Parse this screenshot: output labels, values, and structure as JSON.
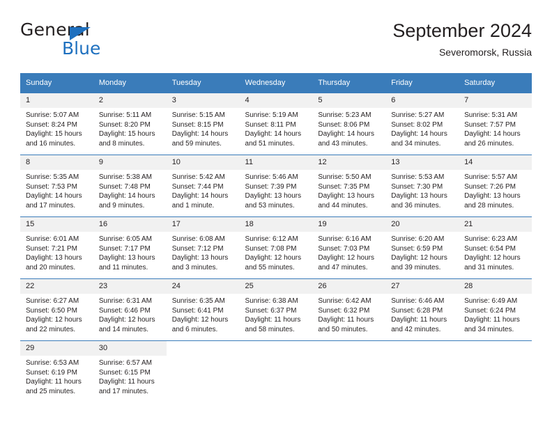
{
  "brand": {
    "name_part1": "General",
    "name_part2": "Blue",
    "triangle_color": "#1e70bf"
  },
  "header": {
    "title": "September 2024",
    "subtitle": "Severomorsk, Russia"
  },
  "theme": {
    "header_blue": "#3a7cba",
    "daynum_bg": "#f1f1f1",
    "text": "#231f20"
  },
  "weekdays": [
    "Sunday",
    "Monday",
    "Tuesday",
    "Wednesday",
    "Thursday",
    "Friday",
    "Saturday"
  ],
  "labels": {
    "sunrise_prefix": "Sunrise:",
    "sunset_prefix": "Sunset:",
    "daylight_prefix": "Daylight:"
  },
  "weeks": [
    [
      {
        "day": "1",
        "sunrise": "Sunrise: 5:07 AM",
        "sunset": "Sunset: 8:24 PM",
        "daylight_l1": "Daylight: 15 hours",
        "daylight_l2": "and 16 minutes."
      },
      {
        "day": "2",
        "sunrise": "Sunrise: 5:11 AM",
        "sunset": "Sunset: 8:20 PM",
        "daylight_l1": "Daylight: 15 hours",
        "daylight_l2": "and 8 minutes."
      },
      {
        "day": "3",
        "sunrise": "Sunrise: 5:15 AM",
        "sunset": "Sunset: 8:15 PM",
        "daylight_l1": "Daylight: 14 hours",
        "daylight_l2": "and 59 minutes."
      },
      {
        "day": "4",
        "sunrise": "Sunrise: 5:19 AM",
        "sunset": "Sunset: 8:11 PM",
        "daylight_l1": "Daylight: 14 hours",
        "daylight_l2": "and 51 minutes."
      },
      {
        "day": "5",
        "sunrise": "Sunrise: 5:23 AM",
        "sunset": "Sunset: 8:06 PM",
        "daylight_l1": "Daylight: 14 hours",
        "daylight_l2": "and 43 minutes."
      },
      {
        "day": "6",
        "sunrise": "Sunrise: 5:27 AM",
        "sunset": "Sunset: 8:02 PM",
        "daylight_l1": "Daylight: 14 hours",
        "daylight_l2": "and 34 minutes."
      },
      {
        "day": "7",
        "sunrise": "Sunrise: 5:31 AM",
        "sunset": "Sunset: 7:57 PM",
        "daylight_l1": "Daylight: 14 hours",
        "daylight_l2": "and 26 minutes."
      }
    ],
    [
      {
        "day": "8",
        "sunrise": "Sunrise: 5:35 AM",
        "sunset": "Sunset: 7:53 PM",
        "daylight_l1": "Daylight: 14 hours",
        "daylight_l2": "and 17 minutes."
      },
      {
        "day": "9",
        "sunrise": "Sunrise: 5:38 AM",
        "sunset": "Sunset: 7:48 PM",
        "daylight_l1": "Daylight: 14 hours",
        "daylight_l2": "and 9 minutes."
      },
      {
        "day": "10",
        "sunrise": "Sunrise: 5:42 AM",
        "sunset": "Sunset: 7:44 PM",
        "daylight_l1": "Daylight: 14 hours",
        "daylight_l2": "and 1 minute."
      },
      {
        "day": "11",
        "sunrise": "Sunrise: 5:46 AM",
        "sunset": "Sunset: 7:39 PM",
        "daylight_l1": "Daylight: 13 hours",
        "daylight_l2": "and 53 minutes."
      },
      {
        "day": "12",
        "sunrise": "Sunrise: 5:50 AM",
        "sunset": "Sunset: 7:35 PM",
        "daylight_l1": "Daylight: 13 hours",
        "daylight_l2": "and 44 minutes."
      },
      {
        "day": "13",
        "sunrise": "Sunrise: 5:53 AM",
        "sunset": "Sunset: 7:30 PM",
        "daylight_l1": "Daylight: 13 hours",
        "daylight_l2": "and 36 minutes."
      },
      {
        "day": "14",
        "sunrise": "Sunrise: 5:57 AM",
        "sunset": "Sunset: 7:26 PM",
        "daylight_l1": "Daylight: 13 hours",
        "daylight_l2": "and 28 minutes."
      }
    ],
    [
      {
        "day": "15",
        "sunrise": "Sunrise: 6:01 AM",
        "sunset": "Sunset: 7:21 PM",
        "daylight_l1": "Daylight: 13 hours",
        "daylight_l2": "and 20 minutes."
      },
      {
        "day": "16",
        "sunrise": "Sunrise: 6:05 AM",
        "sunset": "Sunset: 7:17 PM",
        "daylight_l1": "Daylight: 13 hours",
        "daylight_l2": "and 11 minutes."
      },
      {
        "day": "17",
        "sunrise": "Sunrise: 6:08 AM",
        "sunset": "Sunset: 7:12 PM",
        "daylight_l1": "Daylight: 13 hours",
        "daylight_l2": "and 3 minutes."
      },
      {
        "day": "18",
        "sunrise": "Sunrise: 6:12 AM",
        "sunset": "Sunset: 7:08 PM",
        "daylight_l1": "Daylight: 12 hours",
        "daylight_l2": "and 55 minutes."
      },
      {
        "day": "19",
        "sunrise": "Sunrise: 6:16 AM",
        "sunset": "Sunset: 7:03 PM",
        "daylight_l1": "Daylight: 12 hours",
        "daylight_l2": "and 47 minutes."
      },
      {
        "day": "20",
        "sunrise": "Sunrise: 6:20 AM",
        "sunset": "Sunset: 6:59 PM",
        "daylight_l1": "Daylight: 12 hours",
        "daylight_l2": "and 39 minutes."
      },
      {
        "day": "21",
        "sunrise": "Sunrise: 6:23 AM",
        "sunset": "Sunset: 6:54 PM",
        "daylight_l1": "Daylight: 12 hours",
        "daylight_l2": "and 31 minutes."
      }
    ],
    [
      {
        "day": "22",
        "sunrise": "Sunrise: 6:27 AM",
        "sunset": "Sunset: 6:50 PM",
        "daylight_l1": "Daylight: 12 hours",
        "daylight_l2": "and 22 minutes."
      },
      {
        "day": "23",
        "sunrise": "Sunrise: 6:31 AM",
        "sunset": "Sunset: 6:46 PM",
        "daylight_l1": "Daylight: 12 hours",
        "daylight_l2": "and 14 minutes."
      },
      {
        "day": "24",
        "sunrise": "Sunrise: 6:35 AM",
        "sunset": "Sunset: 6:41 PM",
        "daylight_l1": "Daylight: 12 hours",
        "daylight_l2": "and 6 minutes."
      },
      {
        "day": "25",
        "sunrise": "Sunrise: 6:38 AM",
        "sunset": "Sunset: 6:37 PM",
        "daylight_l1": "Daylight: 11 hours",
        "daylight_l2": "and 58 minutes."
      },
      {
        "day": "26",
        "sunrise": "Sunrise: 6:42 AM",
        "sunset": "Sunset: 6:32 PM",
        "daylight_l1": "Daylight: 11 hours",
        "daylight_l2": "and 50 minutes."
      },
      {
        "day": "27",
        "sunrise": "Sunrise: 6:46 AM",
        "sunset": "Sunset: 6:28 PM",
        "daylight_l1": "Daylight: 11 hours",
        "daylight_l2": "and 42 minutes."
      },
      {
        "day": "28",
        "sunrise": "Sunrise: 6:49 AM",
        "sunset": "Sunset: 6:24 PM",
        "daylight_l1": "Daylight: 11 hours",
        "daylight_l2": "and 34 minutes."
      }
    ],
    [
      {
        "day": "29",
        "sunrise": "Sunrise: 6:53 AM",
        "sunset": "Sunset: 6:19 PM",
        "daylight_l1": "Daylight: 11 hours",
        "daylight_l2": "and 25 minutes."
      },
      {
        "day": "30",
        "sunrise": "Sunrise: 6:57 AM",
        "sunset": "Sunset: 6:15 PM",
        "daylight_l1": "Daylight: 11 hours",
        "daylight_l2": "and 17 minutes."
      },
      {
        "day": "",
        "sunrise": "",
        "sunset": "",
        "daylight_l1": "",
        "daylight_l2": ""
      },
      {
        "day": "",
        "sunrise": "",
        "sunset": "",
        "daylight_l1": "",
        "daylight_l2": ""
      },
      {
        "day": "",
        "sunrise": "",
        "sunset": "",
        "daylight_l1": "",
        "daylight_l2": ""
      },
      {
        "day": "",
        "sunrise": "",
        "sunset": "",
        "daylight_l1": "",
        "daylight_l2": ""
      },
      {
        "day": "",
        "sunrise": "",
        "sunset": "",
        "daylight_l1": "",
        "daylight_l2": ""
      }
    ]
  ]
}
